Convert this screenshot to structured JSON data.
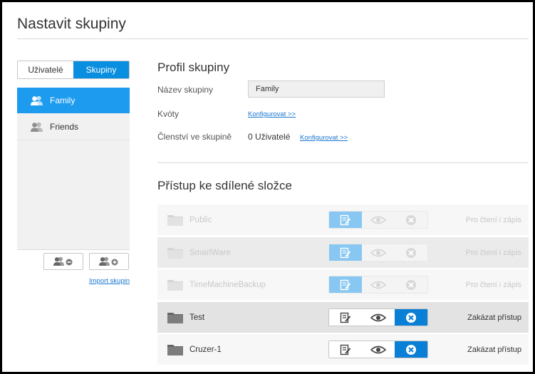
{
  "page": {
    "title": "Nastavit skupiny"
  },
  "left": {
    "tabs": [
      {
        "label": "Uživatelé",
        "active": false
      },
      {
        "label": "Skupiny",
        "active": true
      }
    ],
    "groups": [
      {
        "label": "Family",
        "active": true,
        "icon": "users-icon"
      },
      {
        "label": "Friends",
        "active": false,
        "icon": "users-icon"
      }
    ],
    "remove_icon": "remove-group-icon",
    "add_icon": "add-group-icon",
    "import_label": "Import skupin"
  },
  "profile": {
    "title": "Profil skupiny",
    "name_label": "Název skupiny",
    "name_value": "Family",
    "quota_label": "Kvóty",
    "quota_link": "Konfigurovat >>",
    "membership_label": "Členství ve skupině",
    "membership_value": "0 Uživatelé",
    "membership_link": "Konfigurovat >>"
  },
  "access": {
    "title": "Přístup ke sdílené složce",
    "shares": [
      {
        "name": "Public",
        "access": "Pro čtení i zápis",
        "selected": "edit",
        "dim": true
      },
      {
        "name": "SmartWare",
        "access": "Pro čtení i zápis",
        "selected": "edit",
        "dim": true
      },
      {
        "name": "TimeMachineBackup",
        "access": "Pro čtení i zápis",
        "selected": "edit",
        "dim": true
      },
      {
        "name": "Test",
        "access": "Zakázat přístup",
        "selected": "deny",
        "dim": false
      },
      {
        "name": "Cruzer-1",
        "access": "Zakázat přístup",
        "selected": "deny",
        "dim": false
      }
    ]
  },
  "colors": {
    "accent": "#0a8fe0",
    "link": "#1976d2",
    "selected_row": "#1d9bef"
  }
}
